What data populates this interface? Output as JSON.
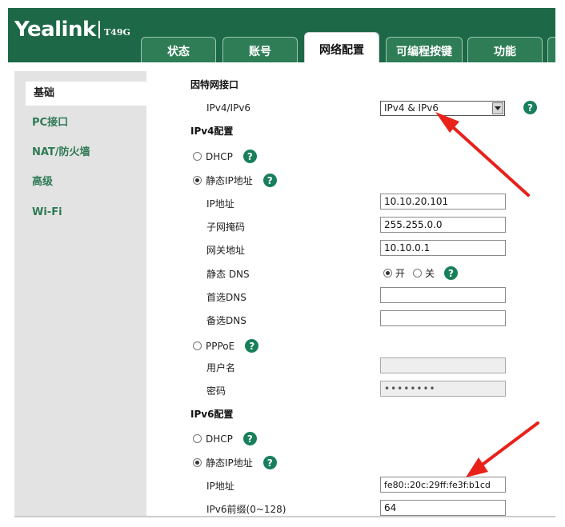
{
  "header": {
    "logo": "Yealink",
    "model": "T49G",
    "tabs": [
      "状态",
      "账号",
      "网络配置",
      "可编程按键",
      "功能"
    ],
    "active_tab": "网络配置"
  },
  "sidebar": {
    "items": [
      "基础",
      "PC接口",
      "NAT/防火墙",
      "高级",
      "Wi-Fi"
    ],
    "active": "基础"
  },
  "internet": {
    "title": "因特网接口",
    "mode_label": "IPv4/IPv6",
    "mode_value": "IPv4 & IPv6"
  },
  "ipv4": {
    "title": "IPv4配置",
    "dhcp_label": "DHCP",
    "static_label": "静态IP地址",
    "ip_label": "IP地址",
    "ip_value": "10.10.20.101",
    "mask_label": "子网掩码",
    "mask_value": "255.255.0.0",
    "gateway_label": "网关地址",
    "gateway_value": "10.10.0.1",
    "static_dns_label": "静态 DNS",
    "dns_on": "开",
    "dns_off": "关",
    "primary_dns_label": "首选DNS",
    "primary_dns_value": "",
    "secondary_dns_label": "备选DNS",
    "secondary_dns_value": "",
    "pppoe_label": "PPPoE",
    "user_label": "用户名",
    "user_value": "",
    "password_label": "密码",
    "password_value": "••••••••"
  },
  "ipv6": {
    "title": "IPv6配置",
    "dhcp_label": "DHCP",
    "static_label": "静态IP地址",
    "ip_label": "IP地址",
    "ip_value": "fe80::20c:29ff:fe3f:b1cd",
    "prefix_label": "IPv6前缀(0~128)",
    "prefix_value": "64"
  },
  "icons": {
    "help_glyph": "?"
  },
  "colors": {
    "brand_green": "#1d6847",
    "help_green": "#17805a",
    "annotation_red": "#e8221b"
  }
}
